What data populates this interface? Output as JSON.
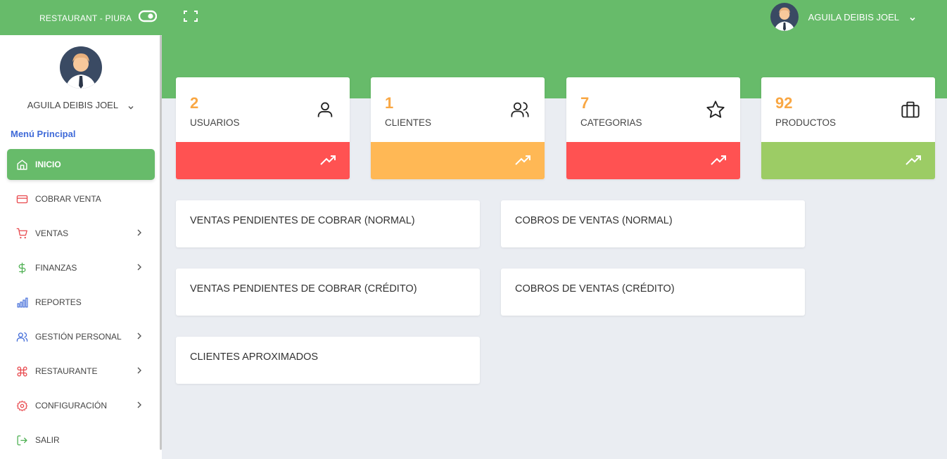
{
  "header": {
    "brand": "RESTAURANT - PIURA",
    "user_name": "AGUILA DEIBIS JOEL",
    "icons": [
      "toggle-icon",
      "fullscreen-icon",
      "chevron-down-icon"
    ]
  },
  "sidebar": {
    "user_name": "AGUILA DEIBIS JOEL",
    "menu_title": "Menú Principal",
    "items": [
      {
        "label": "INICIO",
        "icon": "home-icon",
        "active": true,
        "submenu": false
      },
      {
        "label": "COBRAR VENTA",
        "icon": "credit-card-icon",
        "submenu": false
      },
      {
        "label": "VENTAS",
        "icon": "cart-icon",
        "submenu": true
      },
      {
        "label": "FINANZAS",
        "icon": "dollar-icon",
        "submenu": true
      },
      {
        "label": "REPORTES",
        "icon": "bar-chart-icon",
        "submenu": false
      },
      {
        "label": "GESTIÓN PERSONAL",
        "icon": "users-icon",
        "submenu": true
      },
      {
        "label": "RESTAURANTE",
        "icon": "command-icon",
        "submenu": true
      },
      {
        "label": "CONFIGURACIÓN",
        "icon": "settings-icon",
        "submenu": true
      },
      {
        "label": "SALIR",
        "icon": "logout-icon",
        "submenu": false
      }
    ]
  },
  "stats": [
    {
      "value": "2",
      "label": "USUARIOS",
      "icon": "user-icon",
      "color": "#ff5252"
    },
    {
      "value": "1",
      "label": "CLIENTES",
      "icon": "users-icon",
      "color": "#ffb855"
    },
    {
      "value": "7",
      "label": "CATEGORIAS",
      "icon": "star-icon",
      "color": "#ff5252"
    },
    {
      "value": "92",
      "label": "PRODUCTOS",
      "icon": "briefcase-icon",
      "color": "#9ccc65"
    }
  ],
  "reports": [
    "VENTAS PENDIENTES DE COBRAR (NORMAL)",
    "COBROS DE VENTAS (NORMAL)",
    "VENTAS PENDIENTES DE COBRAR (CRÉDITO)",
    "COBROS DE VENTAS (CRÉDITO)",
    "CLIENTES APROXIMADOS"
  ],
  "colors": {
    "primary_green": "#67bb6a",
    "accent_orange": "#f9a743",
    "menu_title_blue": "#3f6ad8",
    "background": "#eaedf2"
  }
}
